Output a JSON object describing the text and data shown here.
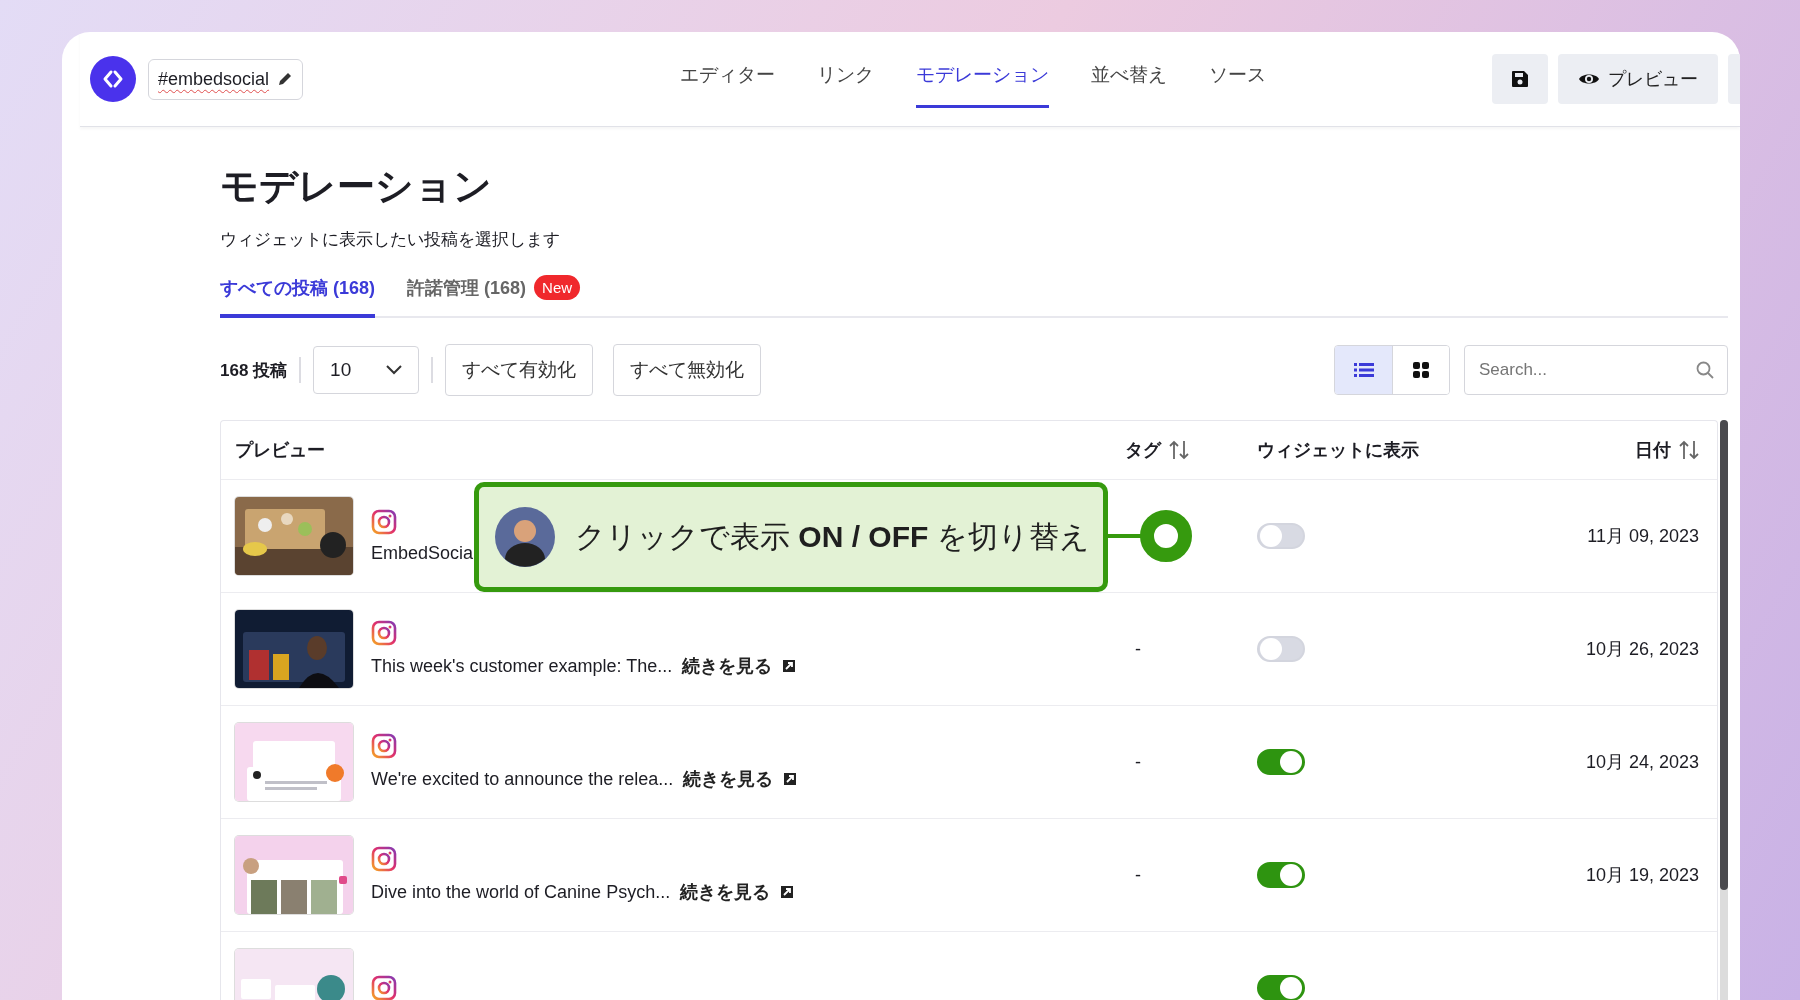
{
  "header": {
    "hashtag": "#embedsocial",
    "preview_button": "プレビュー"
  },
  "nav": [
    {
      "label": "エディター",
      "selected": false
    },
    {
      "label": "リンク",
      "selected": false
    },
    {
      "label": "モデレーション",
      "selected": true
    },
    {
      "label": "並べ替え",
      "selected": false
    },
    {
      "label": "ソース",
      "selected": false
    }
  ],
  "page": {
    "title": "モデレーション",
    "subtitle": "ウィジェットに表示したい投稿を選択します"
  },
  "tabs": [
    {
      "label": "すべての投稿 (168)",
      "selected": true
    },
    {
      "label": "許諾管理 (168)",
      "selected": false,
      "badge": "New"
    }
  ],
  "toolbar": {
    "count": "168 投稿",
    "per_page": "10",
    "enable_all": "すべて有効化",
    "disable_all": "すべて無効化",
    "views": [
      {
        "kind": "list",
        "selected": true
      },
      {
        "kind": "grid",
        "selected": false
      }
    ],
    "search": {
      "placeholder": "Search..."
    }
  },
  "table": {
    "columns": [
      {
        "label": "プレビュー",
        "sortable": false
      },
      {
        "label": "タグ",
        "sortable": true
      },
      {
        "label": "ウィジェットに表示",
        "sortable": false
      },
      {
        "label": "日付",
        "sortable": true
      }
    ],
    "rows": [
      {
        "caption": "EmbedSocia",
        "shown": false,
        "date": "11月 09, 2023"
      },
      {
        "caption": "This week's customer example: The...",
        "link": "続きを見る",
        "tag": "-",
        "shown": false,
        "date": "10月 26, 2023"
      },
      {
        "caption": "We're excited to announce the relea...",
        "link": "続きを見る",
        "tag": "-",
        "shown": true,
        "date": "10月 24, 2023"
      },
      {
        "caption": "Dive into the world of Canine Psych...",
        "link": "続きを見る",
        "tag": "-",
        "shown": true,
        "date": "10月 19, 2023"
      },
      {
        "shown": true
      }
    ]
  },
  "callout": {
    "text": "クリックで表示 **ON / OFF** を切り替え"
  }
}
